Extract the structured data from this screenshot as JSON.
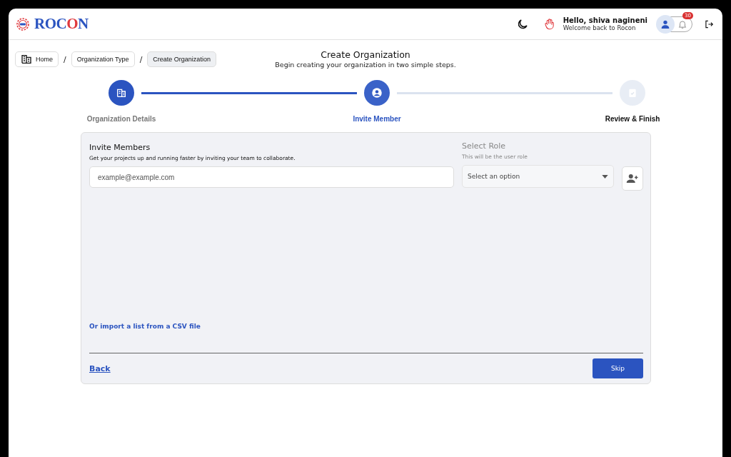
{
  "header": {
    "logo": [
      {
        "text": "ROC",
        "color": "#2b54c0"
      },
      {
        "text": "O",
        "color": "#e03a3e"
      },
      {
        "text": "N",
        "color": "#2b54c0"
      }
    ],
    "greeting": "Hello, shiva nagineni",
    "welcome": "Welcome back to Rocon",
    "notification_count": "30"
  },
  "breadcrumbs": [
    {
      "label": "Home",
      "selected": false
    },
    {
      "label": "Organization Type",
      "selected": false
    },
    {
      "label": "Create Organization",
      "selected": true
    }
  ],
  "separator": "/",
  "page": {
    "title": "Create Organization",
    "subtitle": "Begin creating your organization in two simple steps."
  },
  "steps": [
    {
      "label": "Organization Details",
      "kind": "building",
      "completed": true,
      "selected": false
    },
    {
      "label": "Invite Member",
      "kind": "user",
      "completed": false,
      "selected": true
    },
    {
      "label": "Review & Finish",
      "kind": "clipboard",
      "completed": false,
      "selected": false
    }
  ],
  "form": {
    "title": "Invite Members",
    "description": "Get your projects up and running faster by inviting your team to collaborate.",
    "email_placeholder": "example@example.com",
    "role_title": "Select Role",
    "role_hint": "This will be the user role",
    "role_placeholder": "Select an option",
    "import_link": "Or import a list from a CSV file",
    "back": "Back",
    "skip": "Skip"
  }
}
